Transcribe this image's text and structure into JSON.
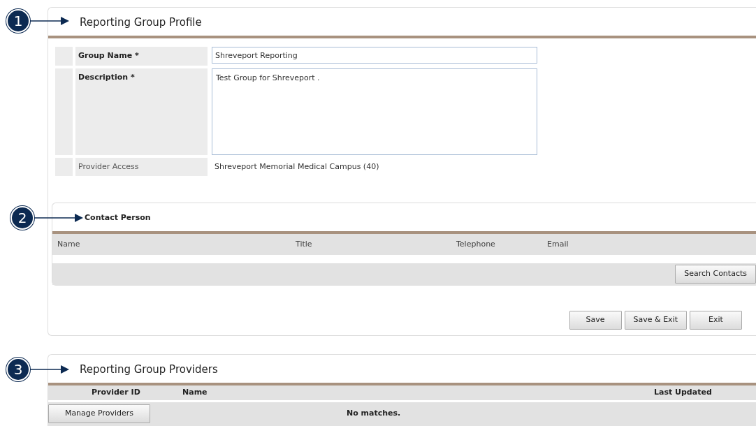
{
  "profile": {
    "callout": "1",
    "title": "Reporting Group Profile",
    "fields": [
      {
        "label": "Group Name *",
        "required": true,
        "kind": "input",
        "value": "Shreveport Reporting"
      },
      {
        "label": "Description *",
        "required": true,
        "kind": "textarea",
        "value": "Test Group for Shreveport ."
      },
      {
        "label": "Provider Access",
        "required": false,
        "kind": "text",
        "value": "Shreveport Memorial Medical Campus (40)"
      }
    ],
    "contact": {
      "callout": "2",
      "title": "Contact Person",
      "columns": [
        "Name",
        "Title",
        "Telephone",
        "Email"
      ],
      "button": "Search Contacts"
    },
    "buttons": [
      "Save",
      "Save & Exit",
      "Exit"
    ]
  },
  "providers": {
    "callout": "3",
    "title": "Reporting Group Providers",
    "columns": [
      "Provider ID",
      "Name",
      "Last Updated"
    ],
    "button": "Manage Providers",
    "empty": "No matches."
  }
}
